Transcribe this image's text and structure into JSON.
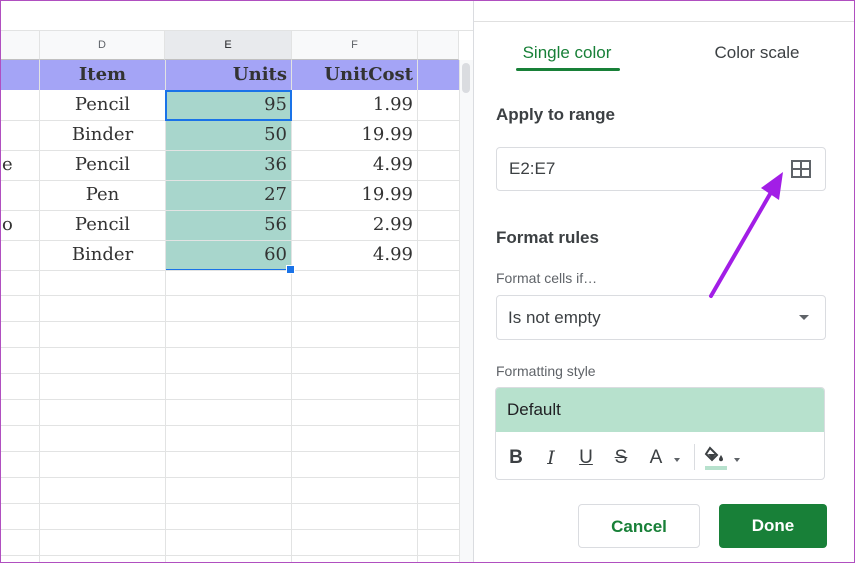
{
  "sheet": {
    "columns": [
      "D",
      "E",
      "F"
    ],
    "header_row": [
      "Item",
      "Units",
      "UnitCost"
    ],
    "rows": [
      {
        "left": "",
        "item": "Pencil",
        "units": "95",
        "cost": "1.99"
      },
      {
        "left": "",
        "item": "Binder",
        "units": "50",
        "cost": "19.99"
      },
      {
        "left": "e",
        "item": "Pencil",
        "units": "36",
        "cost": "4.99"
      },
      {
        "left": "",
        "item": "Pen",
        "units": "27",
        "cost": "19.99"
      },
      {
        "left": "o",
        "item": "Pencil",
        "units": "56",
        "cost": "2.99"
      },
      {
        "left": "",
        "item": "Binder",
        "units": "60",
        "cost": "4.99"
      }
    ],
    "colors": {
      "header_bg": "#a4a4f6",
      "selection": "#a8d6cc",
      "accent": "#1a73e8"
    }
  },
  "panel": {
    "tabs": {
      "single": "Single color",
      "scale": "Color scale"
    },
    "apply_range_label": "Apply to range",
    "range_value": "E2:E7",
    "range_icon": "grid-icon",
    "format_rules_label": "Format rules",
    "format_cells_if_label": "Format cells if…",
    "condition_value": "Is not empty",
    "formatting_style_label": "Formatting style",
    "style_preview": "Default",
    "style_buttons": {
      "bold": "B",
      "italic": "I",
      "underline": "U",
      "strike": "S",
      "text_color": "A"
    },
    "cancel_label": "Cancel",
    "done_label": "Done",
    "colors": {
      "green": "#188038",
      "style_preview_bg": "#b7e1cd",
      "arrow": "#a21ee6"
    }
  }
}
